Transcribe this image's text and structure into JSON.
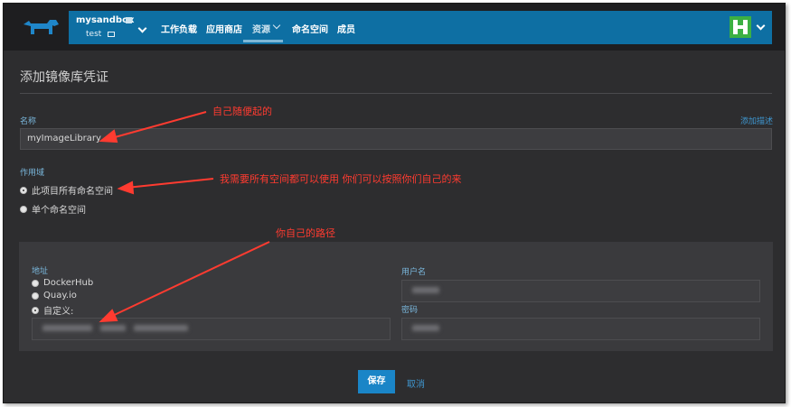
{
  "header": {
    "environment": "mysandbox",
    "project": "test",
    "nav": [
      {
        "label": "工作负载"
      },
      {
        "label": "应用商店"
      },
      {
        "label": "资源"
      },
      {
        "label": "命名空间"
      },
      {
        "label": "成员"
      }
    ],
    "active_nav": "资源"
  },
  "page": {
    "title": "添加镜像库凭证"
  },
  "form": {
    "name_label": "名称",
    "add_description": "添加描述",
    "name_value": "myImageLibrary",
    "scope_label": "作用域",
    "scope_options": [
      {
        "label": "此项目所有命名空间",
        "checked": true
      },
      {
        "label": "单个命名空间",
        "checked": false
      }
    ],
    "address_label": "地址",
    "address_options": [
      {
        "label": "DockerHub",
        "checked": false
      },
      {
        "label": "Quay.io",
        "checked": false
      },
      {
        "label": "自定义:",
        "checked": true
      }
    ],
    "username_label": "用户名",
    "password_label": "密码",
    "save_label": "保存",
    "cancel_label": "取消"
  },
  "annotations": {
    "name_note": "自己随便起的",
    "scope_note": "我需要所有空间都可以使用  你们可以按照你们自己的来",
    "path_note": "你自己的路径"
  },
  "colors": {
    "nav_blue": "#0e6fa3",
    "primary_button": "#1a85c7",
    "annotation_red": "#ff3b30",
    "avatar_green": "#3cb043"
  }
}
